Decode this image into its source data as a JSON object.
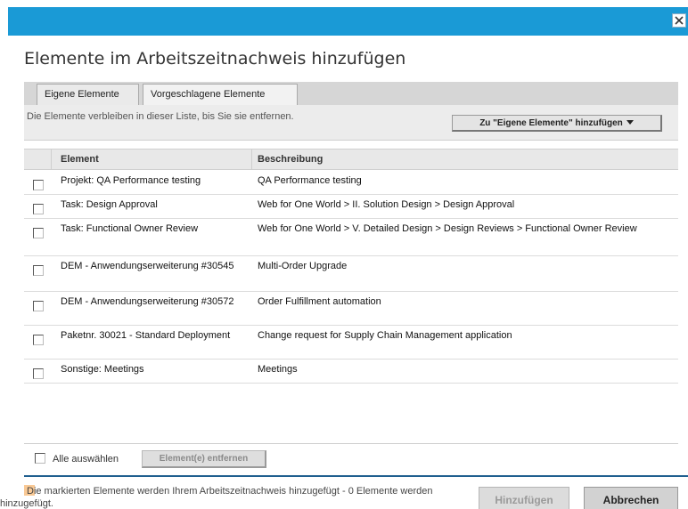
{
  "dialog": {
    "title": "Elemente im Arbeitszeitnachweis hinzufügen",
    "colors": {
      "titlebar": "#1a9ad6",
      "bottom_bar": "#1f5f8f",
      "legend_swatch": "#f9c995"
    }
  },
  "tabs": [
    {
      "label": "Eigene Elemente",
      "active": true
    },
    {
      "label": "Vorgeschlagene Elemente",
      "active": false
    }
  ],
  "info": {
    "text": "Die Elemente verbleiben in dieser Liste, bis Sie sie entfernen.",
    "add_button": "Zu \"Eigene Elemente\" hinzufügen"
  },
  "table": {
    "columns": [
      "Element",
      "Beschreibung"
    ],
    "rows": [
      {
        "element": "Projekt: QA Performance testing",
        "description": "QA Performance testing",
        "checked": false
      },
      {
        "element": "Task: Design Approval",
        "description": "Web for One World > II. Solution Design > Design Approval",
        "checked": false
      },
      {
        "element": "Task: Functional Owner Review",
        "description": "Web for One World > V. Detailed Design > Design Reviews > Functional Owner Review",
        "checked": false
      },
      {
        "element": "DEM - Anwendungserweiterung #30545",
        "description": "Multi-Order Upgrade",
        "checked": false
      },
      {
        "element": "DEM - Anwendungserweiterung #30572",
        "description": "Order Fulfillment automation",
        "checked": false
      },
      {
        "element": "Paketnr. 30021 - Standard Deployment",
        "description": "Change request for Supply Chain Management application",
        "checked": false
      },
      {
        "element": "Sonstige: Meetings",
        "description": "Meetings",
        "checked": false
      }
    ]
  },
  "footer": {
    "select_all": "Alle auswählen",
    "remove_button": "Element(e) entfernen",
    "legend": "Die markierten Elemente werden Ihrem Arbeitszeitnachweis hinzugefügt - 0 Elemente werden hinzugefügt.",
    "add_button": "Hinzufügen",
    "cancel_button": "Abbrechen"
  },
  "icons": [
    "close-icon",
    "caret-down-icon",
    "checkbox-icon"
  ]
}
